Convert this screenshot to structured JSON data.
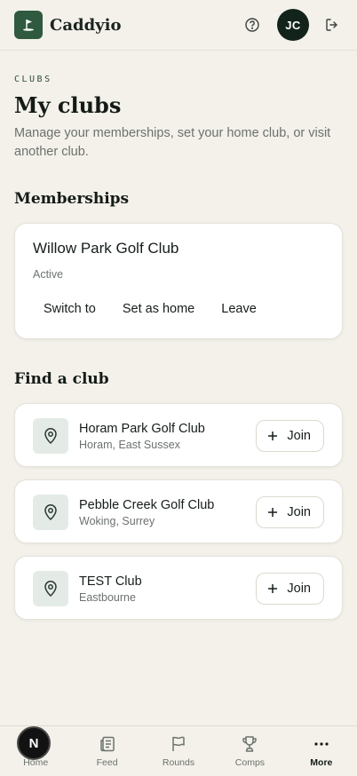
{
  "header": {
    "app_name": "Caddyio",
    "avatar_initials": "JC",
    "icons": [
      "golf-flag-icon",
      "help-icon",
      "logout-icon"
    ]
  },
  "page": {
    "kicker": "CLUBS",
    "title": "My clubs",
    "subtitle": "Manage your memberships, set your home club, or visit another club."
  },
  "memberships": {
    "heading": "Memberships",
    "items": [
      {
        "name": "Willow Park Golf Club",
        "status": "Active",
        "actions": [
          "Switch to",
          "Set as home",
          "Leave"
        ]
      }
    ]
  },
  "find": {
    "heading": "Find a club",
    "join_label": "Join",
    "clubs": [
      {
        "name": "Horam Park Golf Club",
        "location": "Horam, East Sussex"
      },
      {
        "name": "Pebble Creek Golf Club",
        "location": "Woking, Surrey"
      },
      {
        "name": "TEST Club",
        "location": "Eastbourne"
      }
    ]
  },
  "nav": {
    "items": [
      {
        "label": "Home",
        "icon": "home-icon"
      },
      {
        "label": "Feed",
        "icon": "feed-icon"
      },
      {
        "label": "Rounds",
        "icon": "flag-icon"
      },
      {
        "label": "Comps",
        "icon": "trophy-icon"
      },
      {
        "label": "More",
        "icon": "more-icon",
        "active": true
      }
    ],
    "badge": "N"
  },
  "colors": {
    "background": "#f3f1ea",
    "brand": "#2f5a3f",
    "avatar": "#12231b",
    "pin_bg": "#e4ebe6"
  }
}
